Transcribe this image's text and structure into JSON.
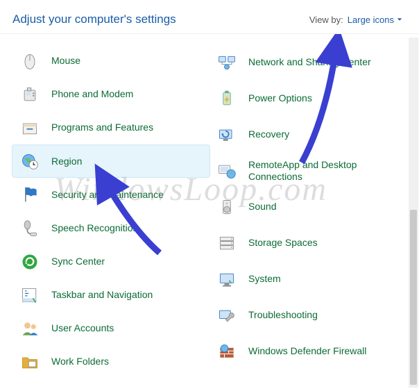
{
  "header": {
    "title": "Adjust your computer's settings"
  },
  "viewby": {
    "label": "View by:",
    "value": "Large icons"
  },
  "left_items": [
    {
      "name": "mouse",
      "label": "Mouse",
      "icon": "mouse"
    },
    {
      "name": "phone-and-modem",
      "label": "Phone and Modem",
      "icon": "phone"
    },
    {
      "name": "programs-and-features",
      "label": "Programs and Features",
      "icon": "box"
    },
    {
      "name": "region",
      "label": "Region",
      "icon": "globe-clock",
      "selected": true
    },
    {
      "name": "security-and-maintenance",
      "label": "Security and Maintenance",
      "icon": "flag"
    },
    {
      "name": "speech-recognition",
      "label": "Speech Recognition",
      "icon": "mic"
    },
    {
      "name": "sync-center",
      "label": "Sync Center",
      "icon": "sync"
    },
    {
      "name": "taskbar-and-navigation",
      "label": "Taskbar and Navigation",
      "icon": "taskbar"
    },
    {
      "name": "user-accounts",
      "label": "User Accounts",
      "icon": "users"
    },
    {
      "name": "work-folders",
      "label": "Work Folders",
      "icon": "folder"
    }
  ],
  "right_items": [
    {
      "name": "network-and-sharing-center",
      "label": "Network and Sharing Center",
      "icon": "network"
    },
    {
      "name": "power-options",
      "label": "Power Options",
      "icon": "battery"
    },
    {
      "name": "recovery",
      "label": "Recovery",
      "icon": "recovery"
    },
    {
      "name": "remoteapp-and-desktop-connections",
      "label": "RemoteApp and Desktop Connections",
      "icon": "remote"
    },
    {
      "name": "sound",
      "label": "Sound",
      "icon": "speaker"
    },
    {
      "name": "storage-spaces",
      "label": "Storage Spaces",
      "icon": "drives"
    },
    {
      "name": "system",
      "label": "System",
      "icon": "system"
    },
    {
      "name": "troubleshooting",
      "label": "Troubleshooting",
      "icon": "wrench"
    },
    {
      "name": "windows-defender-firewall",
      "label": "Windows Defender Firewall",
      "icon": "firewall"
    }
  ],
  "watermark": "WindowsLoop.com"
}
